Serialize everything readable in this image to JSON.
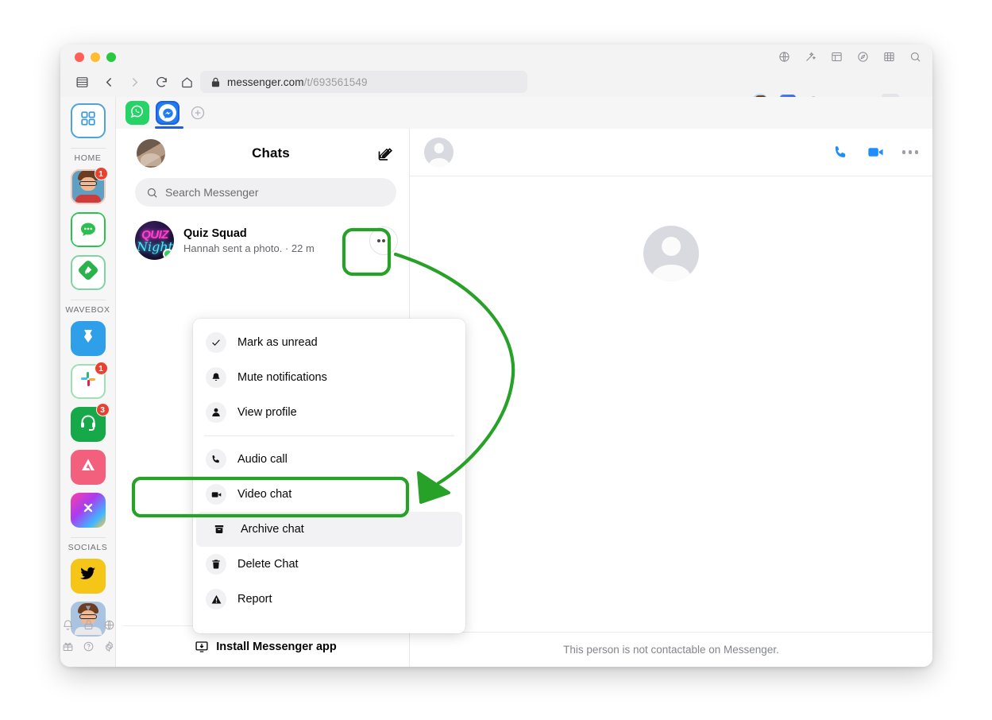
{
  "browser": {
    "url_host": "messenger.com",
    "url_path": "/t/693561549",
    "lock_icon": "lock-icon",
    "nav": {
      "sidebar_icon": "sidebar-toggle-icon",
      "back_icon": "back-icon",
      "forward_icon": "forward-icon",
      "reload_icon": "reload-icon",
      "home_icon": "home-icon"
    },
    "right_icons": [
      "share-icon",
      "star-bookmark-icon",
      "profile-avatar-icon",
      "reader-extension-icon",
      "privacy-badger-icon",
      "extensions-puzzle-icon",
      "playlist-music-icon",
      "account-icon",
      "menu-hamburger-icon"
    ],
    "top_strip_icons": [
      "globe-icon",
      "magic-wand-icon",
      "table-icon",
      "compass-icon",
      "grid-icon",
      "search-icon"
    ]
  },
  "rail": {
    "groups": [
      {
        "label": "HOME",
        "items": [
          {
            "name": "grid-apps-tile",
            "icon": "grid-apps-icon",
            "badge": ""
          }
        ]
      },
      {
        "label": "WAVEBOX",
        "items": [
          {
            "name": "profile-avatar-tile",
            "icon": "avatar-icon",
            "badge": "1"
          },
          {
            "name": "messages-tile",
            "icon": "chat-bubble-icon",
            "badge": ""
          },
          {
            "name": "feedly-tile",
            "icon": "feedly-icon",
            "badge": ""
          }
        ]
      },
      {
        "label": "SOCIALS",
        "items": [
          {
            "name": "bitbucket-tile",
            "icon": "bitbucket-icon",
            "badge": ""
          },
          {
            "name": "slack-tile",
            "icon": "slack-icon",
            "badge": "1"
          },
          {
            "name": "support-tile",
            "icon": "headset-icon",
            "badge": "3"
          },
          {
            "name": "analytics-tile",
            "icon": "analytics-icon",
            "badge": ""
          },
          {
            "name": "gradient-tile",
            "icon": "clipboard-icon",
            "badge": ""
          }
        ]
      },
      {
        "label": "",
        "items": [
          {
            "name": "twitter-tile",
            "icon": "twitter-bird-icon",
            "badge": ""
          },
          {
            "name": "avatar-tile-2",
            "icon": "avatar-icon",
            "badge": ""
          }
        ]
      }
    ],
    "expand_icon": "chevron-down-icon",
    "bottom_icons": [
      "bell-icon",
      "lock-icon",
      "globe-icon",
      "gift-icon",
      "help-icon",
      "settings-gear-icon"
    ]
  },
  "tabstrip": {
    "tabs": [
      {
        "name": "whatsapp-tab",
        "icon": "whatsapp-icon",
        "active": false
      },
      {
        "name": "messenger-tab",
        "icon": "messenger-icon",
        "active": true
      }
    ],
    "add_tab_icon": "plus-circle-icon"
  },
  "chats_panel": {
    "title": "Chats",
    "avatar_icon": "user-avatar",
    "compose_icon": "compose-pencil-icon",
    "search": {
      "placeholder": "Search Messenger",
      "icon": "search-icon",
      "value": ""
    },
    "conversations": [
      {
        "name": "Quiz Squad",
        "preview": "Hannah sent a photo. · 22 m",
        "avatar_label_top": "QUIZ",
        "avatar_label_bottom": "Night",
        "online": true,
        "more_icon": "more-horizontal-icon"
      }
    ],
    "install": {
      "label": "Install Messenger app",
      "icon": "install-desktop-icon"
    }
  },
  "context_menu": {
    "items": [
      {
        "label": "Mark as unread",
        "icon": "check-icon",
        "highlighted": false
      },
      {
        "label": "Mute notifications",
        "icon": "bell-icon",
        "highlighted": false
      },
      {
        "label": "View profile",
        "icon": "person-icon",
        "highlighted": false
      },
      {
        "separator": true
      },
      {
        "label": "Audio call",
        "icon": "phone-icon",
        "highlighted": false
      },
      {
        "label": "Video chat",
        "icon": "video-camera-icon",
        "highlighted": false
      },
      {
        "label": "Archive chat",
        "icon": "archive-box-icon",
        "highlighted": true
      },
      {
        "label": "Delete Chat",
        "icon": "trash-icon",
        "highlighted": false
      },
      {
        "label": "Report",
        "icon": "warning-triangle-icon",
        "highlighted": false
      }
    ]
  },
  "thread_panel": {
    "avatar_icon": "default-person-avatar",
    "actions": [
      {
        "name": "audio-call-button",
        "icon": "phone-icon"
      },
      {
        "name": "video-call-button",
        "icon": "video-camera-icon"
      },
      {
        "name": "conversation-options-button",
        "icon": "more-horizontal-icon"
      }
    ],
    "empty_avatar_icon": "default-person-avatar-large",
    "footer_note": "This person is not contactable on Messenger."
  },
  "annotations": {
    "color": "#27a127",
    "highlight_more_button": true,
    "highlight_archive_item": true,
    "arrow": "curved-arrow-from-more-button-to-archive-chat"
  }
}
